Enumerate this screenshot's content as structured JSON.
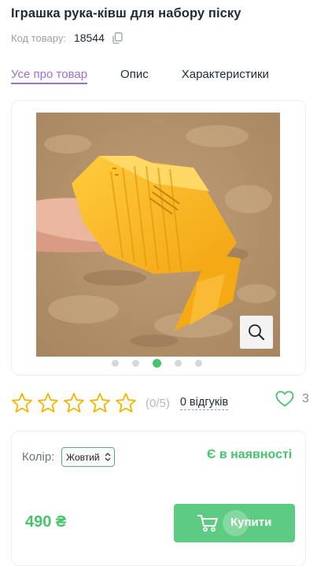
{
  "product": {
    "title": "Іграшка рука-ківш для набору піску",
    "code_label": "Код товару:",
    "code_value": "18544"
  },
  "tabs": [
    {
      "label": "Усе про товар",
      "active": true
    },
    {
      "label": "Опис",
      "active": false
    },
    {
      "label": "Характеристики",
      "active": false
    }
  ],
  "gallery": {
    "image_alt": "Жовта пластикова іграшка-ківш на руці в піску",
    "slide_count": 5,
    "active_slide": 3
  },
  "rating": {
    "stars_filled": 0,
    "stars_total": 5,
    "count_text": "(0/5)",
    "reviews_text": "0 відгуків",
    "favorites_count": "3"
  },
  "purchase": {
    "color_label": "Колір:",
    "color_value": "Жовтий",
    "stock_text": "Є в наявності",
    "price": "490 ₴",
    "buy_label": "Купити"
  },
  "colors": {
    "accent_purple": "#9b6fd6",
    "green": "#46c36b",
    "button_green": "#5ecb82",
    "star_yellow": "#f5b400"
  }
}
